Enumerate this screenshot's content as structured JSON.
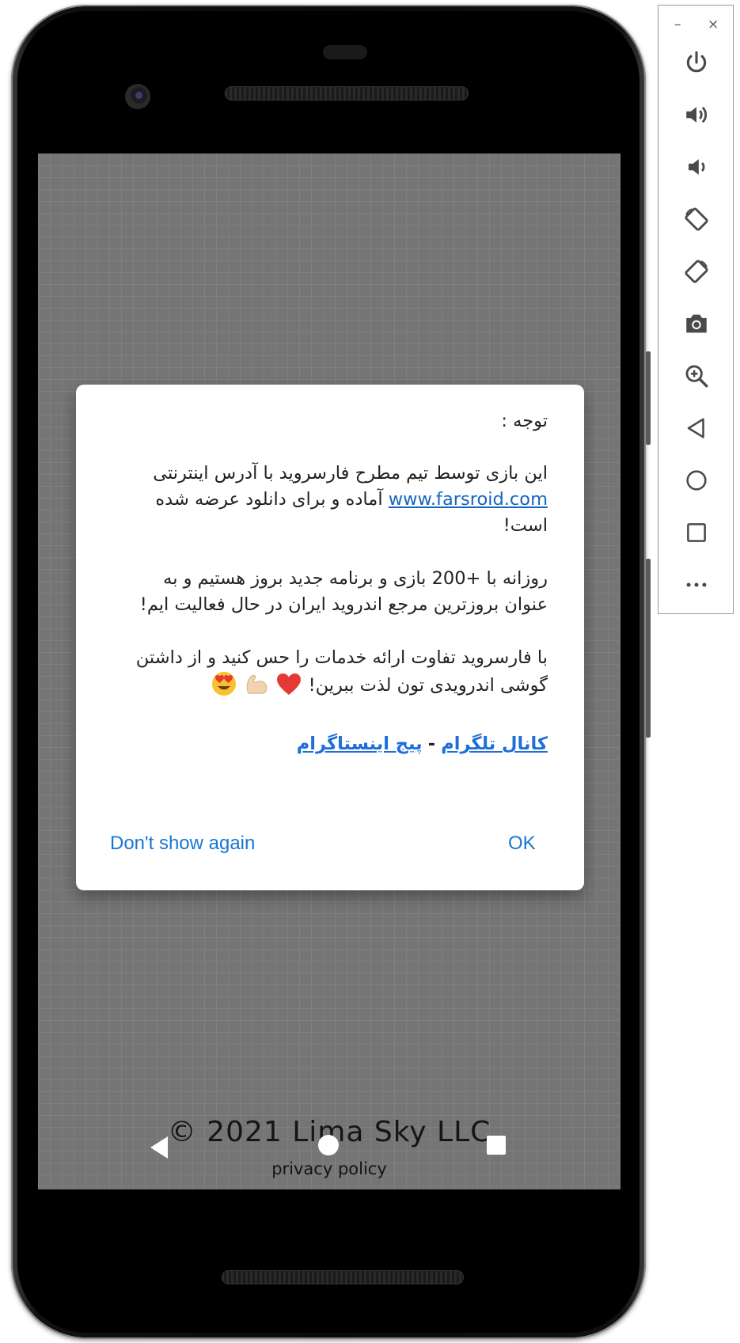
{
  "app": {
    "copyright": "© 2021 Lima Sky LLC",
    "privacy": "privacy policy"
  },
  "dialog": {
    "heading": "توجه :",
    "p1_before": "این بازی توسط تیم مطرح فارسروید با آدرس اینترنتی",
    "p1_link": "www.farsroid.com",
    "p1_after": "آماده و برای دانلود عرضه شده است!",
    "p2": "روزانه با +200 بازی و برنامه جدید بروز هستیم و به عنوان بروزترین مرجع اندروید ایران در حال فعالیت ایم!",
    "p3": "با فارسروید تفاوت ارائه خدمات را حس کنید و از داشتن گوشی اندرویدی تون لذت ببرین!",
    "link_telegram": "کانال تلگرام",
    "link_separator": "-",
    "link_instagram": "پیج اینستاگرام",
    "button_dont_show": "Don't show again",
    "button_ok": "OK"
  },
  "emulator_toolbar": {
    "minimize": "–",
    "close": "×",
    "icons": [
      "power-icon",
      "volume-up-icon",
      "volume-down-icon",
      "rotate-left-icon",
      "rotate-right-icon",
      "camera-icon",
      "zoom-icon",
      "back-icon",
      "home-icon",
      "overview-icon",
      "more-icon"
    ]
  },
  "colors": {
    "link": "#1565c0",
    "button": "#1976d2",
    "screen_bg": "#757575"
  }
}
